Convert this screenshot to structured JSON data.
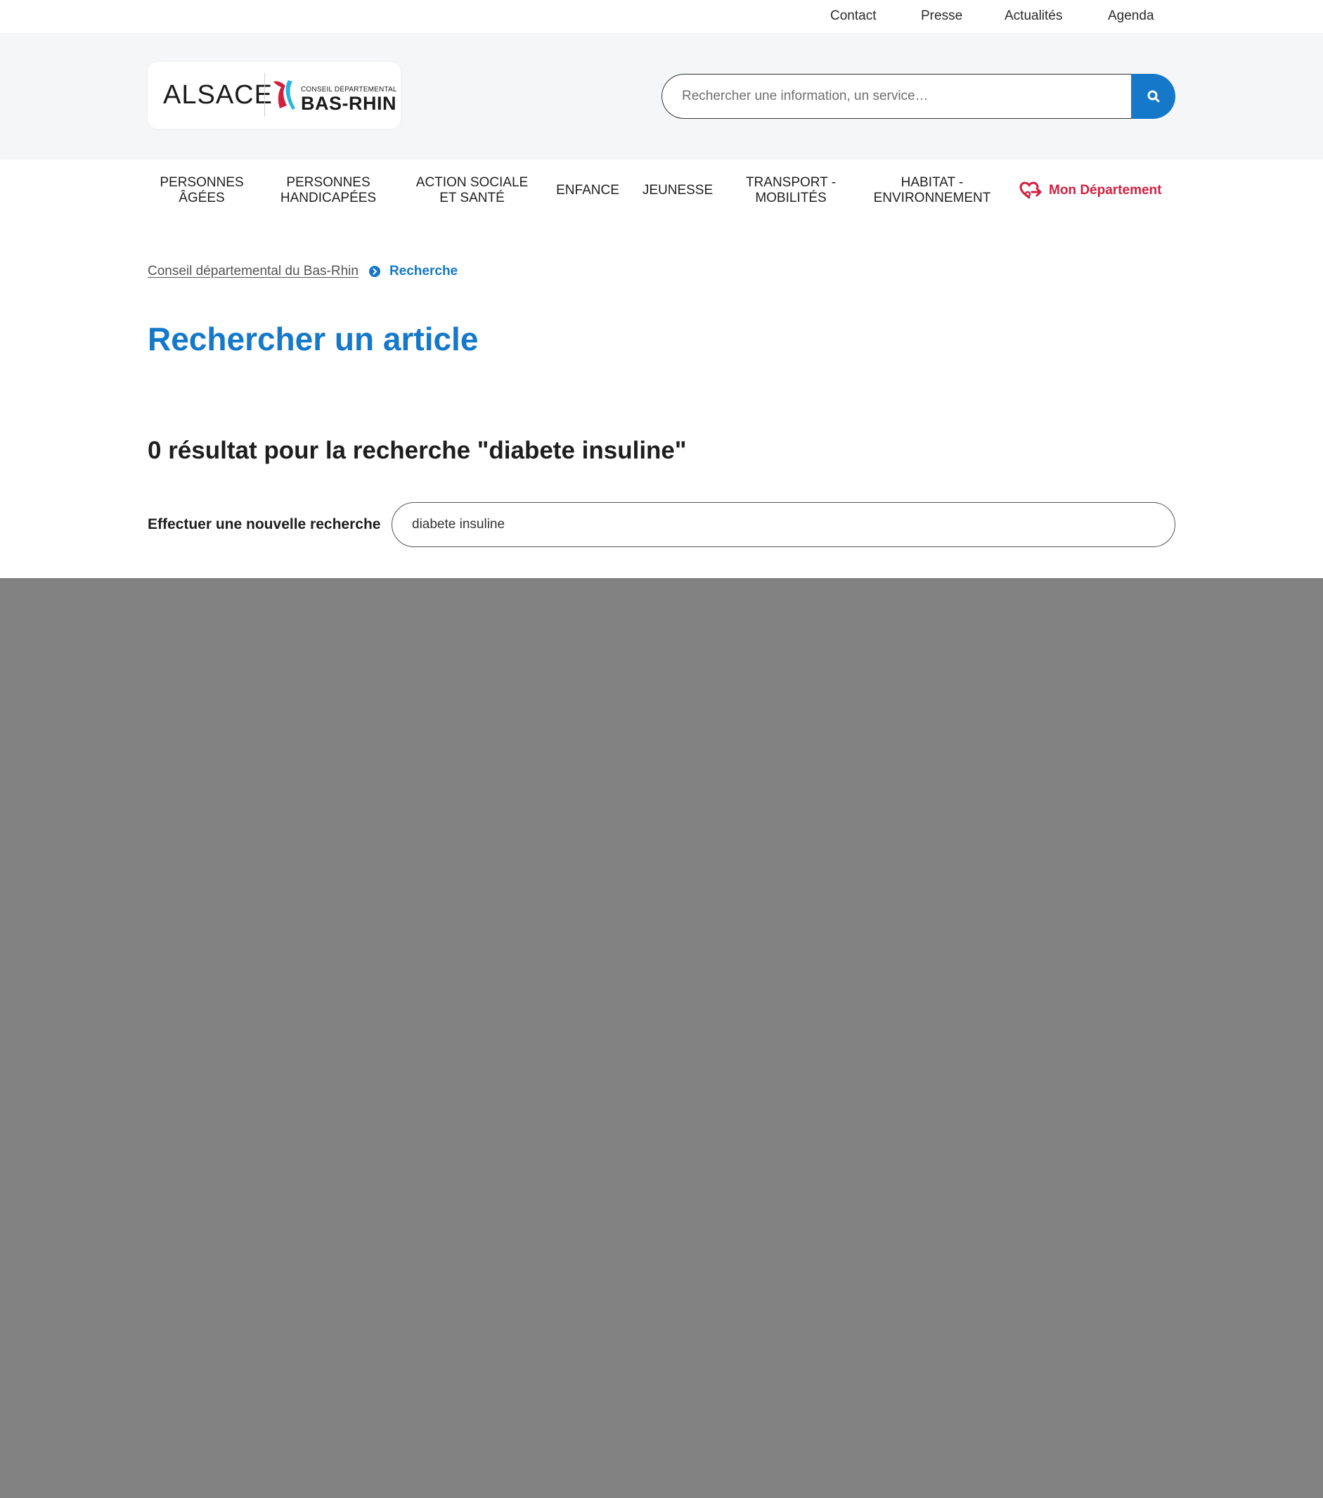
{
  "topnav": [
    {
      "label": "Contact"
    },
    {
      "label": "Presse"
    },
    {
      "label": "Actualités"
    },
    {
      "label": "Agenda"
    }
  ],
  "logo": {
    "left_text": "ALSACE",
    "small_text": "CONSEIL DÉPARTEMENTAL",
    "big_text": "BAS-RHIN"
  },
  "header_search": {
    "placeholder": "Rechercher une information, un service…",
    "icon": "search-icon"
  },
  "mainnav": [
    {
      "label": "PERSONNES\nÂGÉES"
    },
    {
      "label": "PERSONNES\nHANDICAPÉES"
    },
    {
      "label": "ACTION SOCIALE\nET SANTÉ"
    },
    {
      "label": "ENFANCE"
    },
    {
      "label": "JEUNESSE"
    },
    {
      "label": "TRANSPORT -\nMOBILITÉS"
    },
    {
      "label": "HABITAT -\nENVIRONNEMENT"
    }
  ],
  "mon_departement": {
    "label": "Mon Département",
    "icon": "heart-arrow-icon"
  },
  "breadcrumb": {
    "home": "Conseil départemental du Bas-Rhin",
    "current": "Recherche"
  },
  "page_title": "Rechercher un article",
  "results_heading": "0 résultat pour la recherche \"diabete insuline\"",
  "new_search": {
    "label": "Effectuer une nouvelle recherche",
    "value": "diabete insuline"
  },
  "colors": {
    "brand_blue": "#1578c8",
    "accent_red": "#d31f3f",
    "overlay_gray": "#828282"
  }
}
